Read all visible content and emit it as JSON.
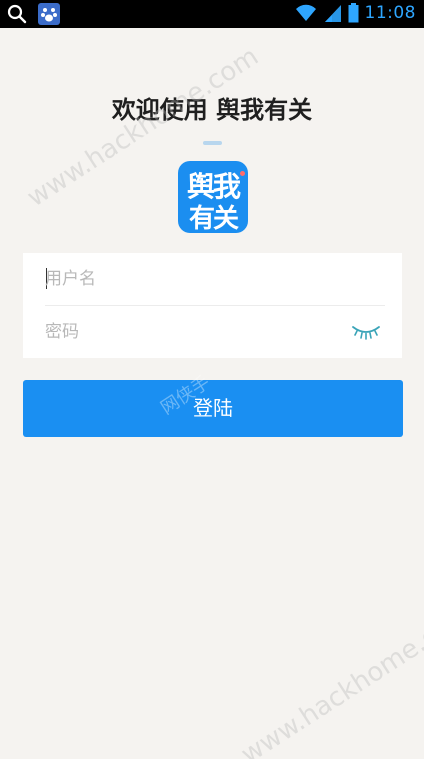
{
  "status_bar": {
    "time": "11:08",
    "icons": [
      "search-icon",
      "app-icon",
      "wifi-icon",
      "signal-icon",
      "battery-icon"
    ]
  },
  "header": {
    "welcome": "欢迎使用 舆我有关"
  },
  "logo": {
    "line1": "舆我",
    "line2": "有关"
  },
  "form": {
    "username_placeholder": "用户名",
    "password_placeholder": "密码"
  },
  "login_button": {
    "label": "登陆"
  },
  "watermarks": {
    "w1": "www.hackhome.com",
    "w2": "www.hackhome.com",
    "w3": "网侠手"
  },
  "colors": {
    "primary": "#1a8ff2",
    "background": "#f5f3f0",
    "status_time": "#2ea6ff"
  }
}
